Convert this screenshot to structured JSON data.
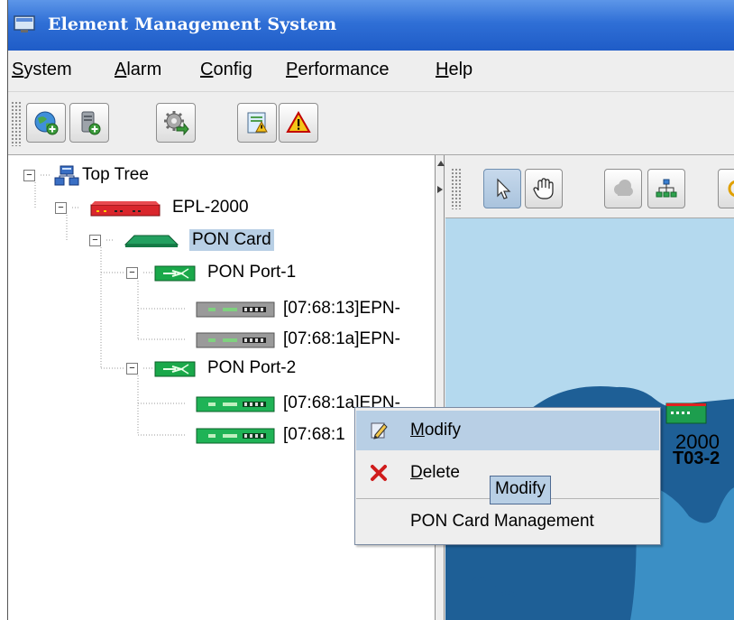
{
  "window": {
    "title": "Element Management System",
    "icon": "ems-app-icon",
    "title_color": "#2f6fd6"
  },
  "menubar": {
    "items": [
      {
        "label": "System",
        "mnemonic": "S",
        "rest": "ystem"
      },
      {
        "label": "Alarm",
        "mnemonic": "A",
        "rest": "larm"
      },
      {
        "label": "Config",
        "mnemonic": "C",
        "rest": "onfig"
      },
      {
        "label": "Performance",
        "mnemonic": "P",
        "rest": "erformance"
      },
      {
        "label": "Help",
        "mnemonic": "H",
        "rest": "elp"
      }
    ]
  },
  "toolbar": {
    "buttons": [
      "globe-add-icon",
      "server-add-icon",
      "gear-arrow-icon",
      "alarm-report-icon",
      "warning-icon"
    ]
  },
  "tree": {
    "root": {
      "label": "Top Tree",
      "icon": "network-tree-icon",
      "toggle": "−"
    },
    "device": {
      "label": "EPL-2000",
      "icon": "red-device-icon",
      "toggle": "−"
    },
    "card": {
      "label": "PON Card",
      "icon": "green-card-icon",
      "toggle": "−"
    },
    "ports": [
      {
        "label": "PON Port-1",
        "icon": "pon-port-icon",
        "toggle": "−",
        "onus": [
          "[07:68:13]EPN-",
          "[07:68:1a]EPN-"
        ],
        "onu_color": "gray"
      },
      {
        "label": "PON Port-2",
        "icon": "pon-port-icon",
        "toggle": "−",
        "onus": [
          "[07:68:1a]EPN-",
          "[07:68:1"
        ],
        "onu_color": "green"
      }
    ],
    "selection_color": "#b8cfe5"
  },
  "map_toolbar": {
    "buttons": [
      "select-pointer-icon",
      "pan-hand-icon",
      "cloud-icon",
      "topology-icon",
      "refresh-icon"
    ]
  },
  "map": {
    "ocean_color": "#b4d9ee",
    "land_color": "#1e5f96",
    "node_label_a": "2000",
    "node_label_b": "T03-2"
  },
  "context_menu": {
    "items": [
      {
        "label": "Modify",
        "mnemonic": "M",
        "rest": "odify",
        "icon": "pencil-edit-icon",
        "highlighted": true
      },
      {
        "label": "Delete",
        "mnemonic": "D",
        "rest": "elete",
        "icon": "red-x-delete-icon",
        "highlighted": false
      },
      {
        "label": "PON Card Management",
        "icon": null,
        "highlighted": false
      }
    ]
  },
  "tooltip": {
    "text": "Modify"
  }
}
